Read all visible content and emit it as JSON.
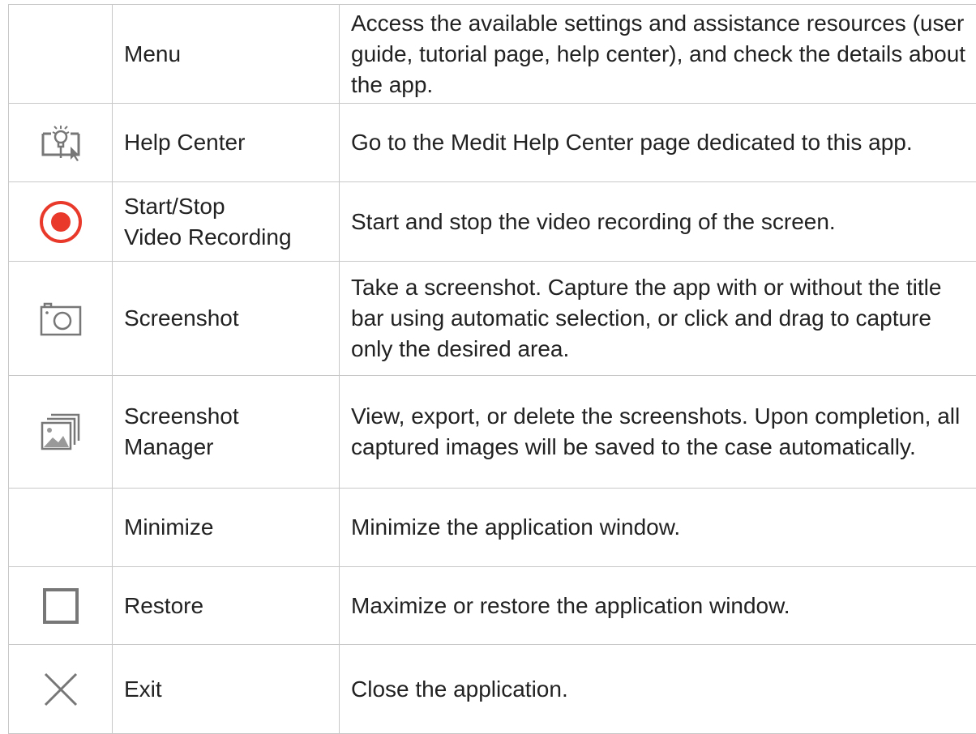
{
  "rows": [
    {
      "icon": "menu-icon",
      "name": [
        "Menu"
      ],
      "description": "Access the available settings and assistance resources (user guide, tutorial page, help center), and check the details about the app."
    },
    {
      "icon": "help-center-icon",
      "name": [
        "Help Center"
      ],
      "description": "Go to the Medit Help Center page dedicated to this app."
    },
    {
      "icon": "record-icon",
      "name": [
        "Start/Stop",
        "Video Recording"
      ],
      "description": "Start and stop the video recording of the screen."
    },
    {
      "icon": "camera-icon",
      "name": [
        "Screenshot"
      ],
      "description": "Take a screenshot. Capture the app with or without the title bar using automatic selection, or click and drag to capture only the desired area."
    },
    {
      "icon": "gallery-icon",
      "name": [
        "Screenshot",
        "Manager"
      ],
      "description": "View, export, or delete the screenshots. Upon completion, all captured images will be saved to the case automatically."
    },
    {
      "icon": "minimize-icon",
      "name": [
        "Minimize"
      ],
      "description": "Minimize the application window."
    },
    {
      "icon": "restore-icon",
      "name": [
        "Restore"
      ],
      "description": "Maximize or restore the application window."
    },
    {
      "icon": "close-icon",
      "name": [
        "Exit"
      ],
      "description": "Close the application."
    }
  ],
  "colors": {
    "record_red": "#e8392b",
    "icon_gray": "#777777",
    "border": "#c8c8c8"
  }
}
